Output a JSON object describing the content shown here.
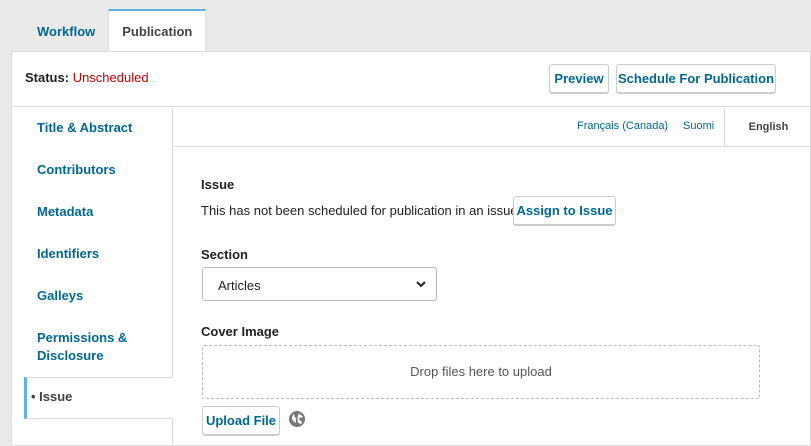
{
  "tabs": [
    {
      "label": "Workflow",
      "active": false
    },
    {
      "label": "Publication",
      "active": true
    }
  ],
  "header": {
    "status_label": "Status:",
    "status_value": "Unscheduled",
    "preview_label": "Preview",
    "schedule_label": "Schedule For Publication"
  },
  "sidebar": {
    "items": [
      {
        "label": "Title & Abstract"
      },
      {
        "label": "Contributors"
      },
      {
        "label": "Metadata"
      },
      {
        "label": "Identifiers"
      },
      {
        "label": "Galleys"
      },
      {
        "label": "Permissions &"
      },
      {
        "label": "Disclosure"
      }
    ],
    "active_label": "• Issue"
  },
  "languages": {
    "items": [
      "Français (Canada)",
      "Suomi"
    ],
    "active": "English"
  },
  "form": {
    "issue_label": "Issue",
    "issue_text": "This has not been scheduled for publication in an issue.",
    "assign_label": "Assign to Issue",
    "section_label": "Section",
    "section_value": "Articles",
    "cover_label": "Cover Image",
    "drop_text": "Drop files here to upload",
    "upload_label": "Upload File"
  },
  "colors": {
    "link": "#006798",
    "status_unscheduled": "#cc0000",
    "active_accent": "#5fb2e0"
  },
  "icons": {
    "select_chevron": "chevron-down-icon",
    "language": "globe-icon"
  }
}
